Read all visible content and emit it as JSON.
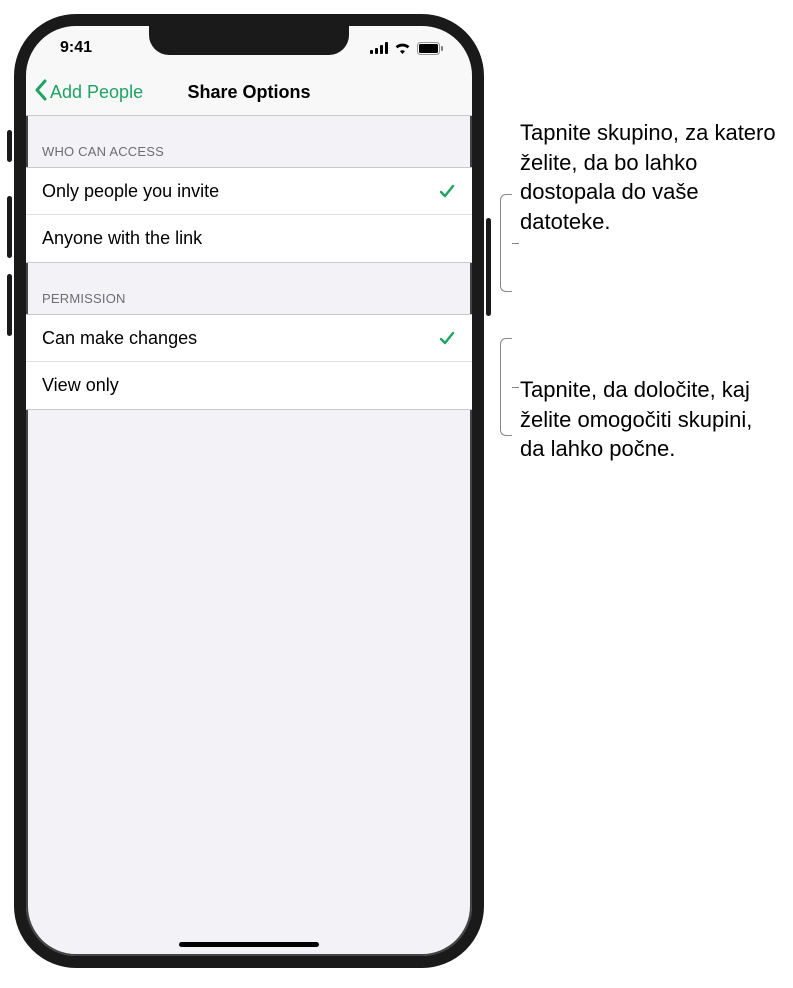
{
  "status": {
    "time": "9:41"
  },
  "nav": {
    "back_label": "Add People",
    "title": "Share Options"
  },
  "sections": {
    "access": {
      "header": "WHO CAN ACCESS",
      "rows": [
        {
          "label": "Only people you invite",
          "checked": true
        },
        {
          "label": "Anyone with the link",
          "checked": false
        }
      ]
    },
    "permission": {
      "header": "PERMISSION",
      "rows": [
        {
          "label": "Can make changes",
          "checked": true
        },
        {
          "label": "View only",
          "checked": false
        }
      ]
    }
  },
  "callouts": {
    "c1": "Tapnite skupino, za katero želite, da bo lahko dostopala do vaše datoteke.",
    "c2": "Tapnite, da določite, kaj želite omogočiti skupini, da lahko počne."
  }
}
